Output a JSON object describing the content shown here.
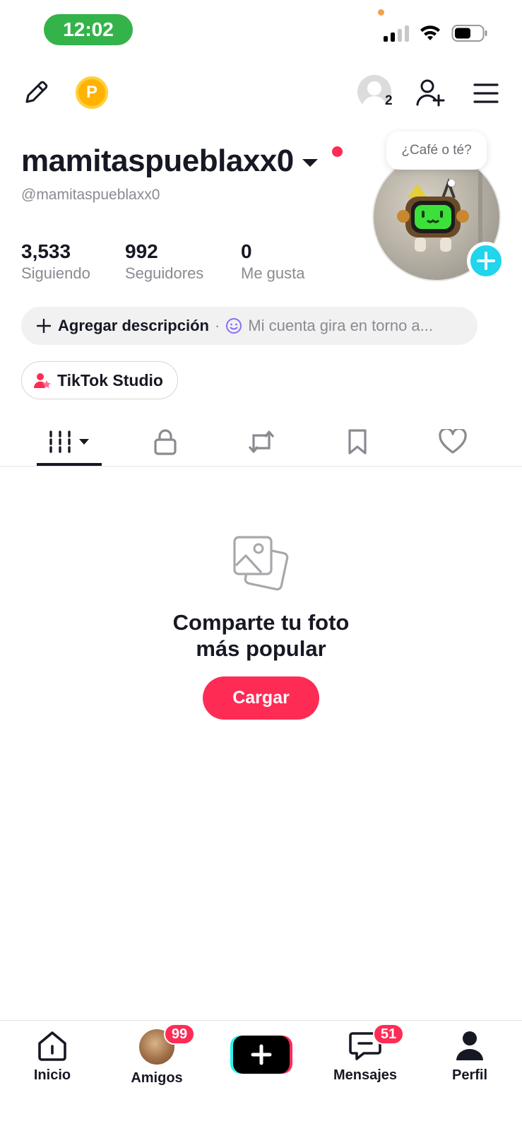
{
  "status_bar": {
    "time": "12:02"
  },
  "top_bar": {
    "visitor_count": "2"
  },
  "profile": {
    "display_name": "mamitaspueblaxx0",
    "handle": "@mamitaspueblaxx0",
    "note_bubble": "¿Café o té?",
    "stats": [
      {
        "value": "3,533",
        "label": "Siguiendo"
      },
      {
        "value": "992",
        "label": "Seguidores"
      },
      {
        "value": "0",
        "label": "Me gusta"
      }
    ],
    "add_description_label": "Agregar descripción",
    "description_placeholder": "Mi cuenta gira en torno a...",
    "studio_label": "TikTok Studio"
  },
  "tabs": [
    {
      "icon": "grid-icon",
      "active": true
    },
    {
      "icon": "lock-icon",
      "active": false
    },
    {
      "icon": "repost-icon",
      "active": false
    },
    {
      "icon": "bookmark-icon",
      "active": false
    },
    {
      "icon": "heart-icon",
      "active": false
    }
  ],
  "empty_state": {
    "title_line1": "Comparte tu foto",
    "title_line2": "más popular",
    "button_label": "Cargar"
  },
  "bottom_nav": {
    "home": "Inicio",
    "friends": "Amigos",
    "friends_badge": "99",
    "messages": "Mensajes",
    "messages_badge": "51",
    "profile": "Perfil"
  },
  "colors": {
    "accent": "#fe2c55",
    "cyan": "#20d5ec",
    "status_time_bg": "#34b34a",
    "coin": "#ffb300"
  }
}
